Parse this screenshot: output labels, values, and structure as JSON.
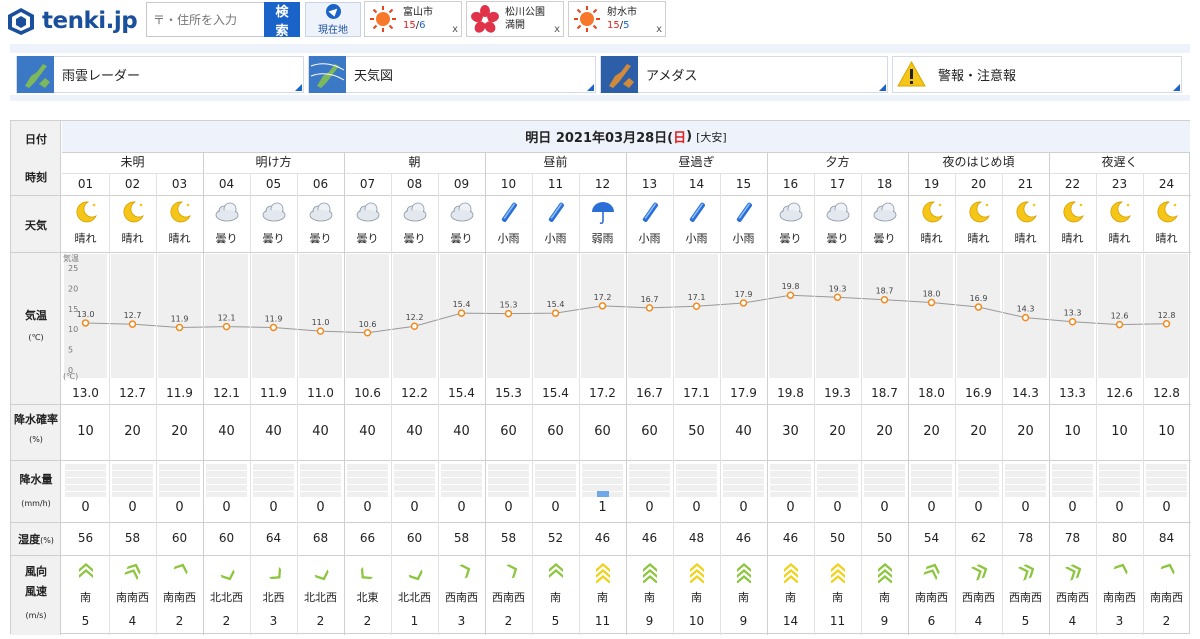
{
  "header": {
    "logo_text": "tenki.jp",
    "search_placeholder": "〒・住所を入力",
    "search_button": "検索",
    "location_button": "現在地"
  },
  "chips": [
    {
      "name": "富山市",
      "hi": "15",
      "lo": "6",
      "icon": "sun-icon"
    },
    {
      "name": "松川公園",
      "sub": "満開",
      "icon": "cherry-blossom-icon"
    },
    {
      "name": "射水市",
      "hi": "15",
      "lo": "5",
      "icon": "sun-icon"
    }
  ],
  "chip_close": "x",
  "nav": [
    {
      "label": "雨雲レーダー",
      "icon": "radar-map-icon"
    },
    {
      "label": "天気図",
      "icon": "weather-chart-icon"
    },
    {
      "label": "アメダス",
      "icon": "amedas-map-icon"
    },
    {
      "label": "警報・注意報",
      "icon": "warning-icon"
    }
  ],
  "table": {
    "labels": {
      "date": "日付",
      "time": "時刻",
      "weather": "天気",
      "temp": "気温",
      "temp_unit": "(℃)",
      "precip_prob": "降水確率",
      "precip_prob_unit": "(%)",
      "precip_amount": "降水量",
      "precip_amount_unit": "(mm/h)",
      "humidity": "湿度",
      "humidity_unit": "(%)",
      "wind_dir": "風向",
      "wind_speed": "風速",
      "wind_speed_unit": "(m/s)"
    },
    "date_text": "明日 2021年03月28日(",
    "date_day": "日",
    "date_close": ")",
    "rokuyo": "[大安]",
    "periods": [
      "未明",
      "明け方",
      "朝",
      "昼前",
      "昼過ぎ",
      "夕方",
      "夜のはじめ頃",
      "夜遅く"
    ],
    "hours": [
      "01",
      "02",
      "03",
      "04",
      "05",
      "06",
      "07",
      "08",
      "09",
      "10",
      "11",
      "12",
      "13",
      "14",
      "15",
      "16",
      "17",
      "18",
      "19",
      "20",
      "21",
      "22",
      "23",
      "24"
    ],
    "weather": [
      "晴れ",
      "晴れ",
      "晴れ",
      "曇り",
      "曇り",
      "曇り",
      "曇り",
      "曇り",
      "曇り",
      "小雨",
      "小雨",
      "弱雨",
      "小雨",
      "小雨",
      "小雨",
      "曇り",
      "曇り",
      "曇り",
      "晴れ",
      "晴れ",
      "晴れ",
      "晴れ",
      "晴れ",
      "晴れ"
    ],
    "weather_icons": [
      "moon-icon",
      "moon-icon",
      "moon-icon",
      "cloud-icon",
      "cloud-icon",
      "cloud-icon",
      "cloud-icon",
      "cloud-icon",
      "cloud-icon",
      "light-rain-icon",
      "light-rain-icon",
      "umbrella-icon",
      "light-rain-icon",
      "light-rain-icon",
      "light-rain-icon",
      "cloud-icon",
      "cloud-icon",
      "cloud-icon",
      "moon-icon",
      "moon-icon",
      "moon-icon",
      "moon-icon",
      "moon-icon",
      "moon-icon"
    ],
    "temps": [
      "13.0",
      "12.7",
      "11.9",
      "12.1",
      "11.9",
      "11.0",
      "10.6",
      "12.2",
      "15.4",
      "15.3",
      "15.4",
      "17.2",
      "16.7",
      "17.1",
      "17.9",
      "19.8",
      "19.3",
      "18.7",
      "18.0",
      "16.9",
      "14.3",
      "13.3",
      "12.6",
      "12.8"
    ],
    "temp_axis_title": "気温",
    "temp_axis_ticks": [
      "25",
      "20",
      "15",
      "10",
      "5",
      "0"
    ],
    "temp_axis_unit": "(℃)",
    "precip_prob": [
      "10",
      "20",
      "20",
      "40",
      "40",
      "40",
      "40",
      "40",
      "40",
      "60",
      "60",
      "60",
      "60",
      "50",
      "40",
      "30",
      "20",
      "20",
      "20",
      "20",
      "20",
      "10",
      "10",
      "10"
    ],
    "precip_amount": [
      "0",
      "0",
      "0",
      "0",
      "0",
      "0",
      "0",
      "0",
      "0",
      "0",
      "0",
      "1",
      "0",
      "0",
      "0",
      "0",
      "0",
      "0",
      "0",
      "0",
      "0",
      "0",
      "0",
      "0"
    ],
    "humidity": [
      "56",
      "58",
      "60",
      "60",
      "64",
      "68",
      "66",
      "60",
      "58",
      "58",
      "52",
      "46",
      "46",
      "48",
      "46",
      "46",
      "50",
      "50",
      "54",
      "62",
      "78",
      "78",
      "80",
      "84"
    ],
    "wind_dirs": [
      "南",
      "南南西",
      "南南西",
      "北北西",
      "北西",
      "北北西",
      "北東",
      "北北西",
      "西南西",
      "西南西",
      "南",
      "南",
      "南",
      "南",
      "南",
      "南",
      "南",
      "南",
      "南南西",
      "西南西",
      "西南西",
      "西南西",
      "南南西",
      "南南西"
    ],
    "wind_speeds": [
      "5",
      "4",
      "2",
      "2",
      "3",
      "2",
      "2",
      "1",
      "3",
      "2",
      "5",
      "11",
      "9",
      "10",
      "9",
      "14",
      "11",
      "9",
      "6",
      "4",
      "5",
      "4",
      "3",
      "2"
    ],
    "colors": {
      "temp_line": "#999999",
      "temp_point": "#f08a1c",
      "rain_bar": "#6fa8e8",
      "wind_weak": "#8cc63f",
      "wind_strong": "#f0d21c"
    }
  }
}
